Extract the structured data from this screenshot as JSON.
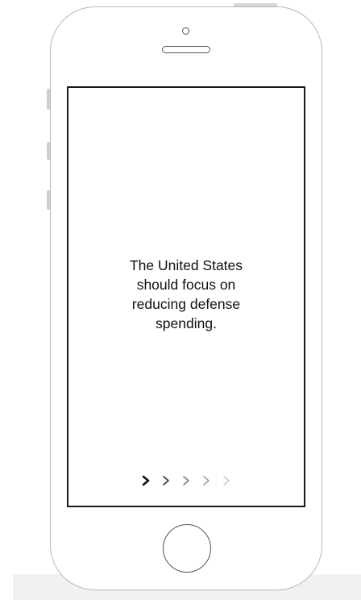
{
  "statement": {
    "text": "The United States should focus on reducing defense spending."
  },
  "pagination": {
    "total": 5,
    "current": 1,
    "icon": "chevron-right-icon",
    "active_color": "#111111",
    "inactive_colors": [
      "#4a4a4a",
      "#7a7a7a",
      "#9a9a9a",
      "#bdbdbd"
    ]
  },
  "device": {
    "type": "smartphone-mockup",
    "screen_background": "#ffffff",
    "frame_color": "#b9b9b9"
  }
}
